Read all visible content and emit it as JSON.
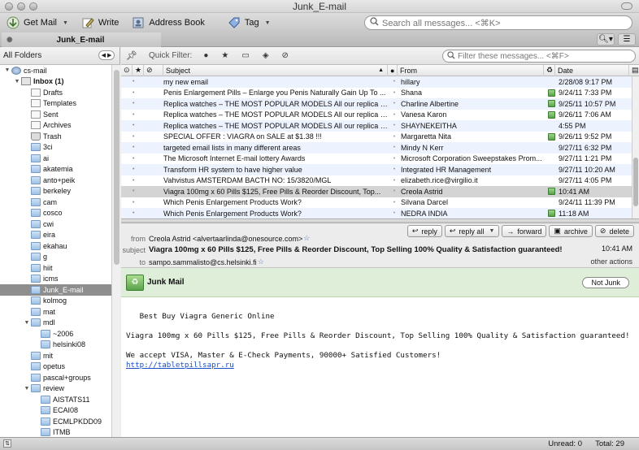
{
  "window": {
    "title": "Junk_E-mail"
  },
  "toolbar": {
    "get_mail": "Get Mail",
    "write": "Write",
    "address_book": "Address Book",
    "tag": "Tag",
    "search_placeholder": "Search all messages... <⌘K>"
  },
  "tab": {
    "label": "Junk_E-mail"
  },
  "folder_pane": {
    "header": "All Folders",
    "folders": [
      {
        "name": "cs-mail",
        "level": 0,
        "twisty": "▼",
        "icon": "acct"
      },
      {
        "name": "Inbox (1)",
        "level": 1,
        "twisty": "▼",
        "icon": "inbox",
        "bold": true
      },
      {
        "name": "Drafts",
        "level": 2,
        "twisty": "",
        "icon": "doc"
      },
      {
        "name": "Templates",
        "level": 2,
        "twisty": "",
        "icon": "doc"
      },
      {
        "name": "Sent",
        "level": 2,
        "twisty": "",
        "icon": "doc"
      },
      {
        "name": "Archives",
        "level": 2,
        "twisty": "",
        "icon": "doc"
      },
      {
        "name": "Trash",
        "level": 2,
        "twisty": "",
        "icon": "trash"
      },
      {
        "name": "3ci",
        "level": 2,
        "twisty": "",
        "icon": "folder"
      },
      {
        "name": "ai",
        "level": 2,
        "twisty": "",
        "icon": "folder"
      },
      {
        "name": "akatemia",
        "level": 2,
        "twisty": "",
        "icon": "folder"
      },
      {
        "name": "anto+peik",
        "level": 2,
        "twisty": "",
        "icon": "folder"
      },
      {
        "name": "berkeley",
        "level": 2,
        "twisty": "",
        "icon": "folder"
      },
      {
        "name": "cam",
        "level": 2,
        "twisty": "",
        "icon": "folder"
      },
      {
        "name": "cosco",
        "level": 2,
        "twisty": "",
        "icon": "folder"
      },
      {
        "name": "cwi",
        "level": 2,
        "twisty": "",
        "icon": "folder"
      },
      {
        "name": "eira",
        "level": 2,
        "twisty": "",
        "icon": "folder"
      },
      {
        "name": "ekahau",
        "level": 2,
        "twisty": "",
        "icon": "folder"
      },
      {
        "name": "g",
        "level": 2,
        "twisty": "",
        "icon": "folder"
      },
      {
        "name": "hiit",
        "level": 2,
        "twisty": "",
        "icon": "folder"
      },
      {
        "name": "icms",
        "level": 2,
        "twisty": "",
        "icon": "folder"
      },
      {
        "name": "Junk_E-mail",
        "level": 2,
        "twisty": "",
        "icon": "folder",
        "selected": true
      },
      {
        "name": "kolmog",
        "level": 2,
        "twisty": "",
        "icon": "folder"
      },
      {
        "name": "mat",
        "level": 2,
        "twisty": "",
        "icon": "folder"
      },
      {
        "name": "mdl",
        "level": 2,
        "twisty": "▼",
        "icon": "folder"
      },
      {
        "name": "~2006",
        "level": 3,
        "twisty": "",
        "icon": "folder"
      },
      {
        "name": "helsinki08",
        "level": 3,
        "twisty": "",
        "icon": "folder"
      },
      {
        "name": "mit",
        "level": 2,
        "twisty": "",
        "icon": "folder"
      },
      {
        "name": "opetus",
        "level": 2,
        "twisty": "",
        "icon": "folder"
      },
      {
        "name": "pascal+groups",
        "level": 2,
        "twisty": "",
        "icon": "folder"
      },
      {
        "name": "review",
        "level": 2,
        "twisty": "▼",
        "icon": "folder"
      },
      {
        "name": "AISTATS11",
        "level": 3,
        "twisty": "",
        "icon": "folder"
      },
      {
        "name": "ECAI08",
        "level": 3,
        "twisty": "",
        "icon": "folder"
      },
      {
        "name": "ECMLPKDD09",
        "level": 3,
        "twisty": "",
        "icon": "folder"
      },
      {
        "name": "ITMB",
        "level": 3,
        "twisty": "",
        "icon": "folder"
      }
    ]
  },
  "quick_filter": {
    "label": "Quick Filter:",
    "placeholder": "Filter these messages... <⌘F>"
  },
  "message_list": {
    "columns": {
      "subject": "Subject",
      "from": "From",
      "date": "Date"
    },
    "rows": [
      {
        "subject": "my new email",
        "from": "hillary",
        "date": "2/28/08 9:17 PM",
        "junk": false
      },
      {
        "subject": "Penis Enlargement Pills – Enlarge you Penis Naturally Gain Up To ...",
        "from": "Shana",
        "date": "9/24/11 7:33 PM",
        "junk": true
      },
      {
        "subject": "Replica watches – THE MOST POPULAR MODELS All our replica wa...",
        "from": "Charline Albertine",
        "date": "9/25/11 10:57 PM",
        "junk": true
      },
      {
        "subject": "Replica watches – THE MOST POPULAR MODELS All our replica wa...",
        "from": "Vanesa Karon",
        "date": "9/26/11 7:06 AM",
        "junk": true
      },
      {
        "subject": "Replica watches – THE MOST POPULAR MODELS All our replica wa...",
        "from": "SHAYNEKEITHA",
        "date": "4:55 PM",
        "junk": false
      },
      {
        "subject": "SPECIAL OFFER : VIAGRA on SALE at $1.38 !!!",
        "from": "Margaretta Nita",
        "date": "9/26/11 9:52 PM",
        "junk": true
      },
      {
        "subject": "targeted email lists in many different areas",
        "from": "Mindy N Kerr",
        "date": "9/27/11 6:32 PM",
        "junk": false
      },
      {
        "subject": "The Microsoft Internet E-mail lottery Awards",
        "from": "Microsoft Corporation Sweepstakes Prom...",
        "date": "9/27/11 1:21 PM",
        "junk": false
      },
      {
        "subject": "Transform HR system to have higher value",
        "from": "Integrated HR Management",
        "date": "9/27/11 10:20 AM",
        "junk": false
      },
      {
        "subject": "Vahvistus AMSTERDAM BACTH NO: 15/3820/MGL",
        "from": "elizabeth.rice@virgilio.it",
        "date": "9/27/11 4:05 PM",
        "junk": false
      },
      {
        "subject": "Viagra 100mg x 60 Pills $125, Free Pills & Reorder Discount, Top...",
        "from": "Creola Astrid",
        "date": "10:41 AM",
        "junk": true,
        "selected": true
      },
      {
        "subject": "Which Penis Enlargement Products Work?",
        "from": "Silvana Darcel",
        "date": "9/24/11 11:39 PM",
        "junk": false
      },
      {
        "subject": "Which Penis Enlargement Products Work?",
        "from": "NEDRA INDIA",
        "date": "11:18 AM",
        "junk": true
      }
    ]
  },
  "header_pane": {
    "from_label": "from",
    "from_value": "Creola Astrid <alvertaarlinda@onesource.com>",
    "subject_label": "subject",
    "subject_value": "Viagra 100mg x 60 Pills $125, Free Pills & Reorder Discount, Top Selling 100% Quality & Satisfaction guaranteed!",
    "to_label": "to",
    "to_value": "sampo.sammalisto@cs.helsinki.fi",
    "time": "10:41 AM",
    "other_actions": "other actions",
    "actions": {
      "reply": "reply",
      "reply_all": "reply all",
      "forward": "forward",
      "archive": "archive",
      "delete": "delete"
    }
  },
  "junk_bar": {
    "label": "Junk Mail",
    "not_junk": "Not Junk"
  },
  "body": {
    "line1": "   Best Buy Viagra Generic Online",
    "line2": "Viagra 100mg x 60 Pills $125, Free Pills & Reorder Discount, Top Selling 100% Quality & Satisfaction guaranteed!",
    "line3": "We accept VISA, Master & E-Check Payments, 90000+ Satisfied Customers!",
    "link": "http://tabletpillsapr.ru"
  },
  "status": {
    "unread": "Unread: 0",
    "total": "Total: 29"
  }
}
